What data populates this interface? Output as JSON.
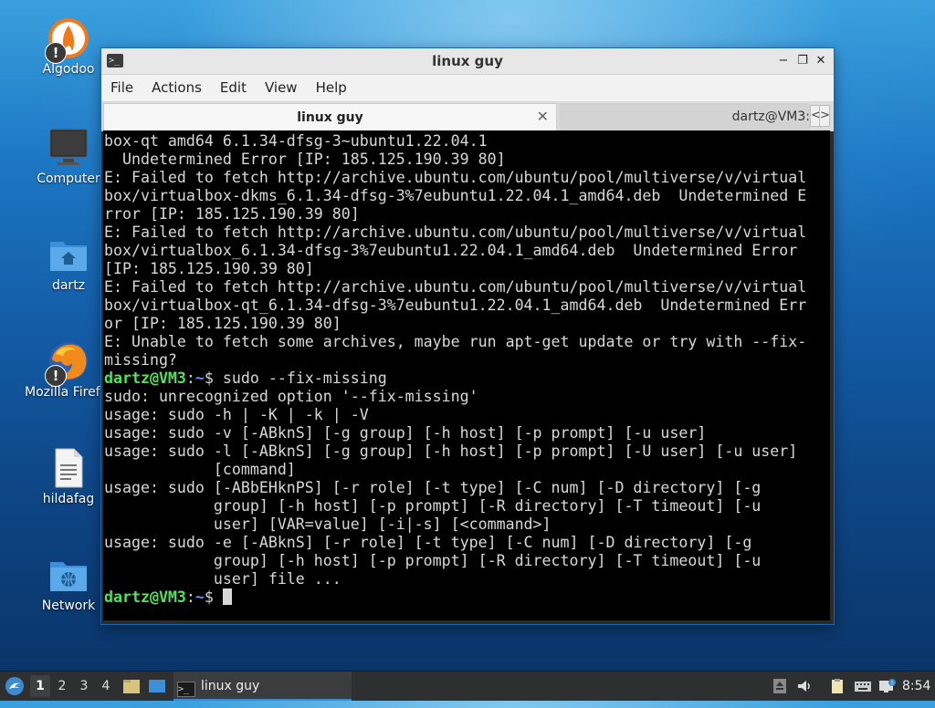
{
  "desktop": {
    "icons": [
      {
        "label": "Algodoo",
        "icon": "algodoo-icon",
        "warning": "!"
      },
      {
        "label": "Computer",
        "icon": "computer-icon"
      },
      {
        "label": "dartz",
        "icon": "home-folder-icon"
      },
      {
        "label": "Mozilla Firef",
        "icon": "firefox-icon",
        "warning": "!"
      },
      {
        "label": "hildafag",
        "icon": "text-file-icon"
      },
      {
        "label": "Network",
        "icon": "network-folder-icon"
      }
    ]
  },
  "window": {
    "title": "linux guy",
    "controls": {
      "minimize": "−",
      "maximize": "❐",
      "close": "✕"
    },
    "menu": [
      "File",
      "Actions",
      "Edit",
      "View",
      "Help"
    ],
    "tabs": [
      {
        "label": "linux guy",
        "active": true,
        "close": "✕"
      },
      {
        "label": "dartz@VM3:",
        "active": false
      }
    ],
    "tab_nav": {
      "prev": "<",
      "next": ">"
    }
  },
  "terminal": {
    "prompt_user": "dartz@VM3",
    "prompt_path": "~",
    "lines": [
      {
        "text": "box-qt amd64 6.1.34-dfsg-3~ubuntu1.22.04.1"
      },
      {
        "text": "  Undetermined Error [IP: 185.125.190.39 80]"
      },
      {
        "text": "E: Failed to fetch http://archive.ubuntu.com/ubuntu/pool/multiverse/v/virtual"
      },
      {
        "text": "box/virtualbox-dkms_6.1.34-dfsg-3%7eubuntu1.22.04.1_amd64.deb  Undetermined E"
      },
      {
        "text": "rror [IP: 185.125.190.39 80]"
      },
      {
        "text": "E: Failed to fetch http://archive.ubuntu.com/ubuntu/pool/multiverse/v/virtual"
      },
      {
        "text": "box/virtualbox_6.1.34-dfsg-3%7eubuntu1.22.04.1_amd64.deb  Undetermined Error"
      },
      {
        "text": "[IP: 185.125.190.39 80]"
      },
      {
        "text": "E: Failed to fetch http://archive.ubuntu.com/ubuntu/pool/multiverse/v/virtual"
      },
      {
        "text": "box/virtualbox-qt_6.1.34-dfsg-3%7eubuntu1.22.04.1_amd64.deb  Undetermined Err"
      },
      {
        "text": "or [IP: 185.125.190.39 80]"
      },
      {
        "text": "E: Unable to fetch some archives, maybe run apt-get update or try with --fix-"
      },
      {
        "text": "missing?"
      },
      {
        "prompt": true,
        "text": "$ sudo --fix-missing"
      },
      {
        "text": "sudo: unrecognized option '--fix-missing'"
      },
      {
        "text": "usage: sudo -h | -K | -k | -V"
      },
      {
        "text": "usage: sudo -v [-ABknS] [-g group] [-h host] [-p prompt] [-u user]"
      },
      {
        "text": "usage: sudo -l [-ABknS] [-g group] [-h host] [-p prompt] [-U user] [-u user]"
      },
      {
        "text": "            [command]"
      },
      {
        "text": "usage: sudo [-ABbEHknPS] [-r role] [-t type] [-C num] [-D directory] [-g"
      },
      {
        "text": "            group] [-h host] [-p prompt] [-R directory] [-T timeout] [-u"
      },
      {
        "text": "            user] [VAR=value] [-i|-s] [<command>]"
      },
      {
        "text": "usage: sudo -e [-ABknS] [-r role] [-t type] [-C num] [-D directory] [-g"
      },
      {
        "text": "            group] [-h host] [-p prompt] [-R directory] [-T timeout] [-u"
      },
      {
        "text": "            user] file ..."
      },
      {
        "prompt": true,
        "text": "$ ",
        "cursor": true
      }
    ]
  },
  "taskbar": {
    "workspaces": [
      "1",
      "2",
      "3",
      "4"
    ],
    "active_workspace": "1",
    "task_label": "linux guy",
    "clock": "8:54"
  }
}
